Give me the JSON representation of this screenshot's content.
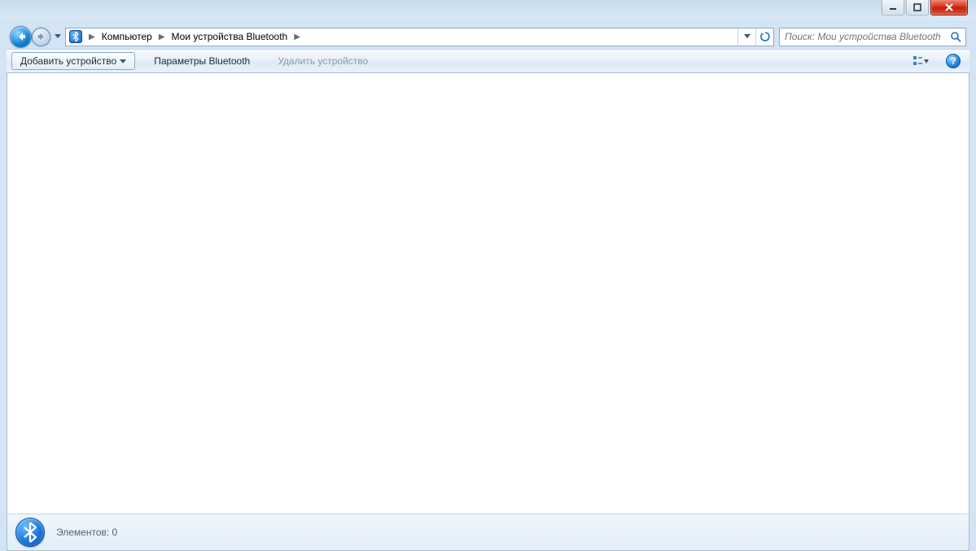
{
  "breadcrumb": {
    "root": "Компьютер",
    "current": "Мои устройства Bluetooth"
  },
  "search": {
    "placeholder": "Поиск: Мои устройства Bluetooth"
  },
  "toolbar": {
    "add_device": "Добавить устройство",
    "bt_settings": "Параметры Bluetooth",
    "remove_device": "Удалить устройство"
  },
  "details": {
    "items_label": "Элементов:",
    "items_count": "0"
  }
}
